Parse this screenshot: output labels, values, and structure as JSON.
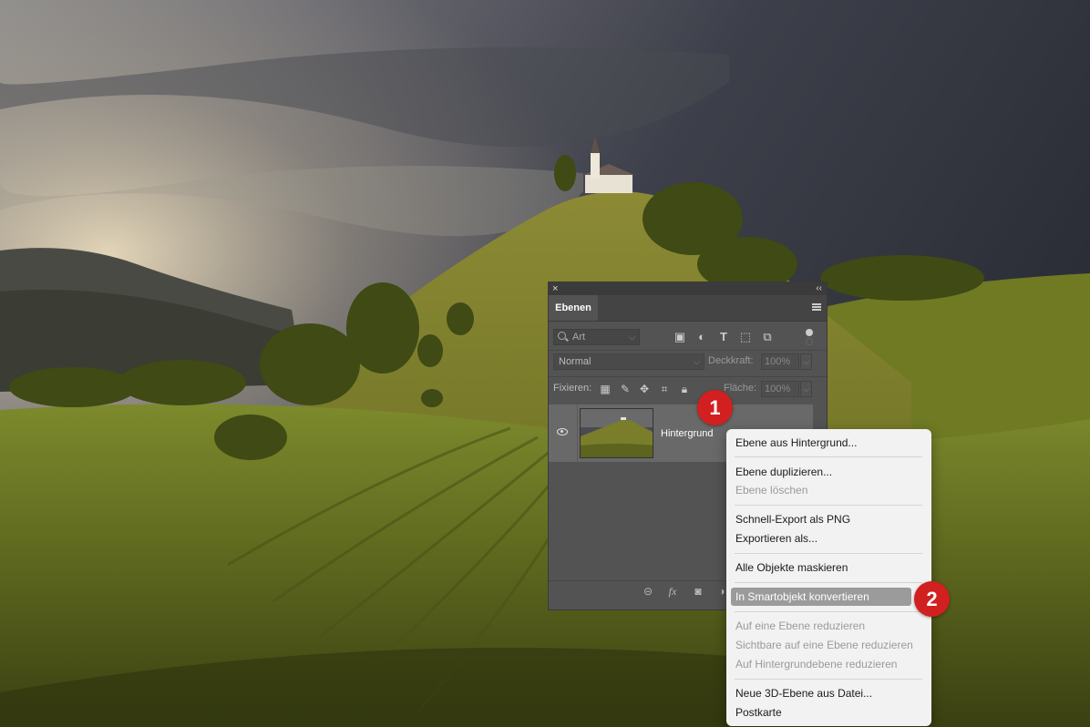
{
  "panel": {
    "close_glyph": "×",
    "collapse_glyph": "‹‹",
    "tab_label": "Ebenen",
    "filter": {
      "placeholder": "Art"
    },
    "blend_mode": "Normal",
    "opacity_label": "Deckkraft:",
    "opacity_value": "100%",
    "lock_label": "Fixieren:",
    "fill_label": "Fläche:",
    "fill_value": "100%",
    "layers": [
      {
        "name": "Hintergrund",
        "visible": true
      }
    ],
    "filter_icons": [
      "image-filter-icon",
      "adjustment-filter-icon",
      "type-filter-icon",
      "shape-filter-icon",
      "smartobject-filter-icon"
    ],
    "lock_icons": [
      "lock-transparent-icon",
      "lock-paint-icon",
      "lock-position-icon",
      "lock-artboard-icon",
      "lock-all-icon"
    ],
    "bottom_icons": [
      "link-icon",
      "fx-icon",
      "mask-icon",
      "adjustment-icon"
    ]
  },
  "context_menu": {
    "items": [
      {
        "label": "Ebene aus Hintergrund...",
        "disabled": false
      },
      {
        "label": "Ebene duplizieren...",
        "disabled": false
      },
      {
        "label": "Ebene löschen",
        "disabled": true
      },
      {
        "label": "Schnell-Export als PNG",
        "disabled": false
      },
      {
        "label": "Exportieren als...",
        "disabled": false
      },
      {
        "label": "Alle Objekte maskieren",
        "disabled": false
      },
      {
        "label": "In Smartobjekt konvertieren",
        "disabled": false,
        "highlighted": true
      },
      {
        "label": "Auf eine Ebene reduzieren",
        "disabled": true
      },
      {
        "label": "Sichtbare auf eine Ebene reduzieren",
        "disabled": true
      },
      {
        "label": "Auf Hintergrundebene reduzieren",
        "disabled": true
      },
      {
        "label": "Neue 3D-Ebene aus Datei...",
        "disabled": false
      },
      {
        "label": "Postkarte",
        "disabled": false
      }
    ]
  },
  "badges": {
    "step1": "1",
    "step2": "2",
    "color": "#d21f1f"
  }
}
